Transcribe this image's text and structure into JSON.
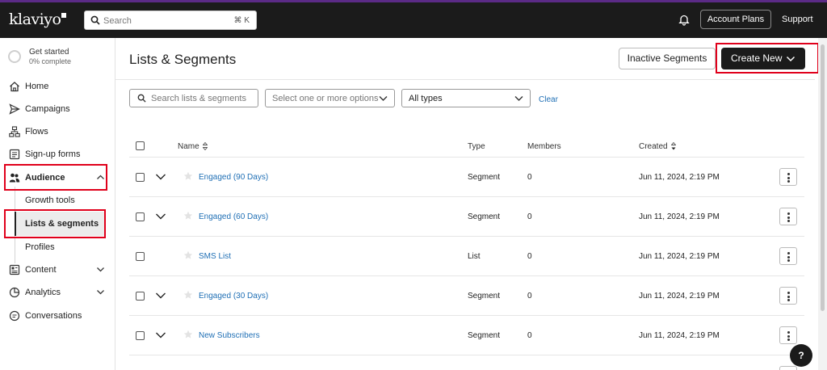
{
  "app": {
    "logo_text": "klaviyo"
  },
  "topbar": {
    "search_placeholder": "Search",
    "search_shortcut": "⌘ K",
    "account_plans_label": "Account Plans",
    "support_label": "Support"
  },
  "sidebar": {
    "get_started": {
      "title": "Get started",
      "progress": "0% complete"
    },
    "items": [
      {
        "label": "Home",
        "icon": "home-icon"
      },
      {
        "label": "Campaigns",
        "icon": "send-icon"
      },
      {
        "label": "Flows",
        "icon": "flow-icon"
      },
      {
        "label": "Sign-up forms",
        "icon": "form-icon"
      },
      {
        "label": "Audience",
        "icon": "audience-icon",
        "expanded": true
      },
      {
        "label": "Content",
        "icon": "content-icon"
      },
      {
        "label": "Analytics",
        "icon": "chart-icon"
      },
      {
        "label": "Conversations",
        "icon": "chat-icon"
      }
    ],
    "audience_sub": [
      {
        "label": "Growth tools"
      },
      {
        "label": "Lists & segments",
        "active": true
      },
      {
        "label": "Profiles"
      }
    ]
  },
  "main": {
    "title": "Lists & Segments",
    "inactive_segments_label": "Inactive Segments",
    "create_new_label": "Create New",
    "filters": {
      "search_placeholder": "Search lists & segments",
      "options_placeholder": "Select one or more options",
      "type_value": "All types",
      "clear_label": "Clear"
    },
    "table": {
      "headers": {
        "name": "Name",
        "type": "Type",
        "members": "Members",
        "created": "Created"
      },
      "rows": [
        {
          "name": "Engaged (90 Days)",
          "type": "Segment",
          "members": "0",
          "created": "Jun 11, 2024, 2:19 PM",
          "expandable": true
        },
        {
          "name": "Engaged (60 Days)",
          "type": "Segment",
          "members": "0",
          "created": "Jun 11, 2024, 2:19 PM",
          "expandable": true
        },
        {
          "name": "SMS List",
          "type": "List",
          "members": "0",
          "created": "Jun 11, 2024, 2:19 PM",
          "expandable": false
        },
        {
          "name": "Engaged (30 Days)",
          "type": "Segment",
          "members": "0",
          "created": "Jun 11, 2024, 2:19 PM",
          "expandable": true
        },
        {
          "name": "New Subscribers",
          "type": "Segment",
          "members": "0",
          "created": "Jun 11, 2024, 2:19 PM",
          "expandable": true
        }
      ]
    }
  },
  "help_label": "?",
  "colors": {
    "topbar": "#1b1b1b",
    "accent_strip": "#5b2a86",
    "link": "#1f6fb5",
    "highlight_box": "#e0001b"
  }
}
